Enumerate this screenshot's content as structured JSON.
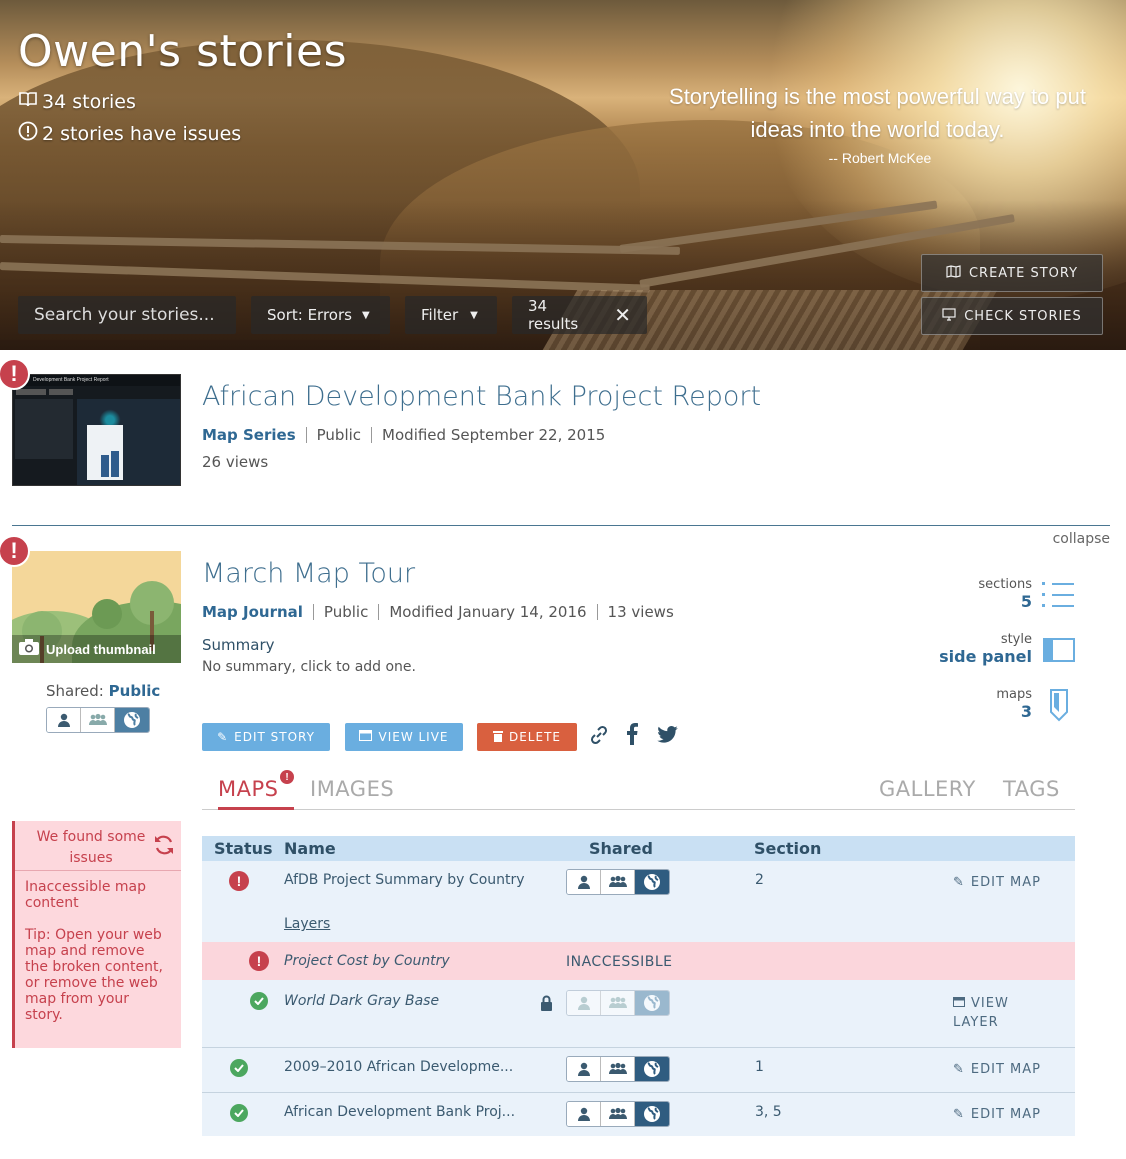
{
  "header": {
    "title": "Owen's stories",
    "stories_count": "34 stories",
    "issues_count": "2 stories have issues",
    "quote": "Storytelling is the most powerful way to put ideas into the world today.",
    "quote_author": "-- Robert McKee",
    "search_placeholder": "Search your stories...",
    "sort_label": "Sort: Errors",
    "filter_label": "Filter",
    "results_label": "34 results",
    "create_story": "CREATE STORY",
    "check_stories": "CHECK STORIES"
  },
  "stories": [
    {
      "title": "African Development Bank Project Report",
      "type": "Map Series",
      "access": "Public",
      "modified": "Modified September 22, 2015",
      "views": "26 views",
      "thumb_title": "Development Bank Project Report"
    },
    {
      "title": "March Map Tour",
      "type": "Map Journal",
      "access": "Public",
      "modified": "Modified January 14, 2016",
      "views": "13 views",
      "upload_thumbnail": "Upload thumbnail",
      "summary_label": "Summary",
      "summary_text": "No summary, click to add one.",
      "shared_label": "Shared:",
      "shared_value": "Public",
      "collapse": "collapse",
      "sections_label": "sections",
      "sections_value": "5",
      "style_label": "style",
      "style_value": "side panel",
      "maps_label": "maps",
      "maps_value": "3",
      "actions": {
        "edit": "EDIT STORY",
        "view_live": "VIEW LIVE",
        "delete": "DELETE"
      },
      "tabs": [
        "MAPS",
        "IMAGES",
        "GALLERY",
        "TAGS"
      ],
      "issues_panel": {
        "title": "We found some issues",
        "message": "Inaccessible map content",
        "tip": "Tip: Open your web map and remove the broken content, or remove the web map from your story."
      },
      "table": {
        "headers": [
          "Status",
          "Name",
          "Shared",
          "Section"
        ],
        "rows": [
          {
            "name": "AfDB Project Summary by Country",
            "section": "2",
            "action": "EDIT MAP",
            "sublink": "Layers"
          },
          {
            "name": "Project Cost by Country",
            "status_text": "INACCESSIBLE"
          },
          {
            "name": "World Dark Gray Base",
            "action_line1": "VIEW",
            "action_line2": "LAYER"
          },
          {
            "name": "2009–2010 African Developme...",
            "section": "1",
            "action": "EDIT MAP"
          },
          {
            "name": "African Development Bank Proj...",
            "section": "3, 5",
            "action": "EDIT MAP"
          }
        ]
      }
    }
  ],
  "colors": {
    "accent_blue": "#2f6893",
    "error_red": "#c6414d",
    "ok_green": "#4ca75f",
    "edit_button": "#6aaee0",
    "view_button": "#6aaee0",
    "delete_button": "#d9603f"
  }
}
